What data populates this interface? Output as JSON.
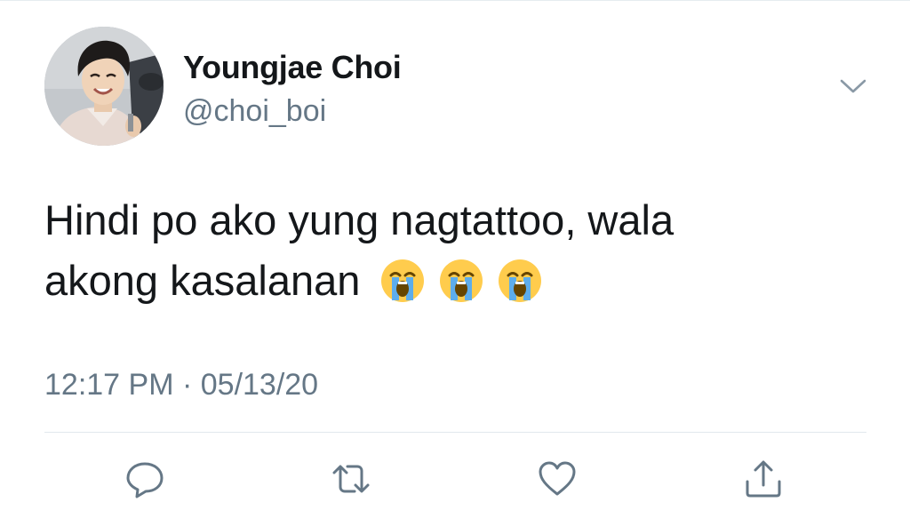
{
  "tweet": {
    "author": {
      "display_name": "Youngjae Choi",
      "handle": "@choi_boi"
    },
    "text_line1": "Hindi po ako yung nagtattoo, wala",
    "text_line2": "akong kasalanan",
    "emojis": [
      "loudly-crying-face",
      "loudly-crying-face",
      "loudly-crying-face"
    ],
    "timestamp": "12:17 PM · 05/13/20"
  },
  "icons": {
    "menu": "chevron-down-icon",
    "reply": "reply-icon",
    "retweet": "retweet-icon",
    "like": "heart-icon",
    "share": "share-icon"
  },
  "colors": {
    "text_primary": "#14171a",
    "text_secondary": "#657786",
    "icon": "#657786",
    "divider": "#e1e8ed"
  }
}
